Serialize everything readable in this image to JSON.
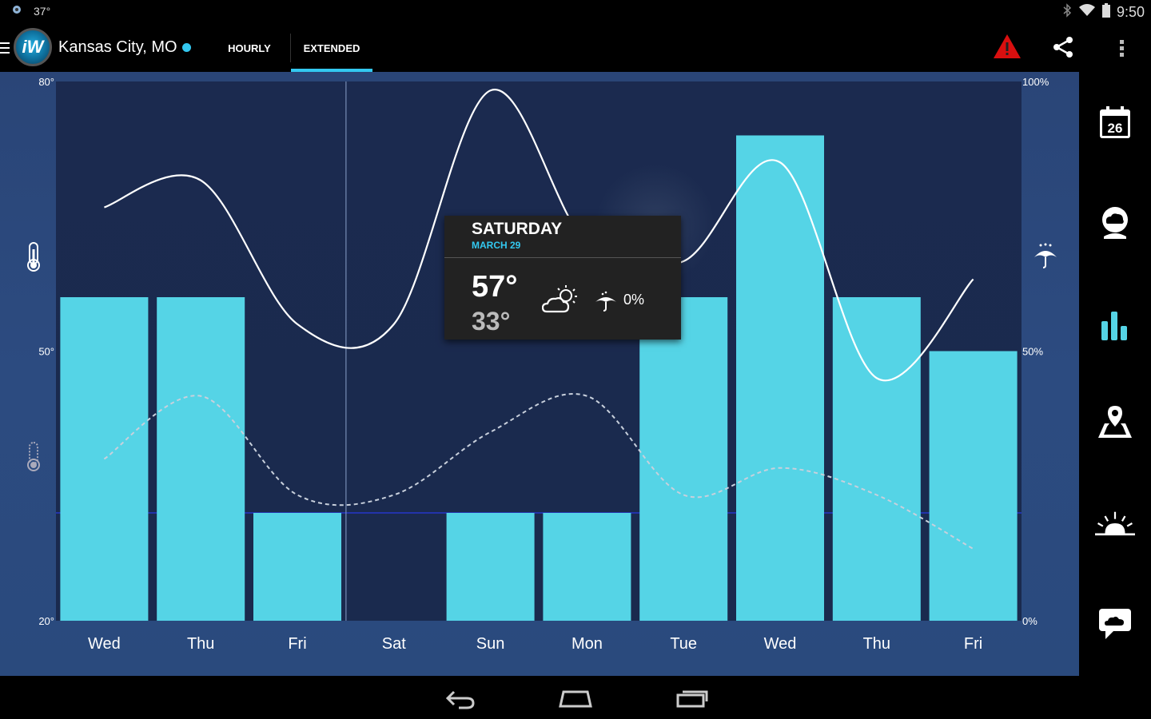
{
  "status_bar": {
    "temp": "37°",
    "time": "9:50"
  },
  "header": {
    "location": "Kansas City, MO",
    "logo_text": "iW",
    "tabs": [
      {
        "label": "HOURLY"
      },
      {
        "label": "EXTENDED"
      }
    ],
    "active_tab": "EXTENDED"
  },
  "sidebar": {
    "items": [
      {
        "icon": "calendar-icon",
        "label": "26"
      },
      {
        "icon": "weather-globe-icon"
      },
      {
        "icon": "bar-chart-icon"
      },
      {
        "icon": "map-icon"
      },
      {
        "icon": "sunrise-icon"
      },
      {
        "icon": "chat-cloud-icon"
      }
    ]
  },
  "tooltip": {
    "day": "SATURDAY",
    "date": "MARCH 29",
    "high": "57°",
    "low": "33°",
    "precip": "0%"
  },
  "colors": {
    "accent": "#33c8f0",
    "bar": "#55d4e6",
    "background": "#2a4577",
    "plot": "#1c2a4d"
  },
  "chart_data": {
    "type": "bar",
    "categories": [
      "Wed",
      "Thu",
      "Fri",
      "Sat",
      "Sun",
      "Mon",
      "Tue",
      "Wed",
      "Thu",
      "Fri"
    ],
    "precip_percent": [
      60,
      60,
      20,
      0,
      20,
      20,
      60,
      90,
      60,
      50
    ],
    "high_temps": [
      66,
      69,
      53,
      53,
      79,
      62,
      60,
      71,
      47,
      58
    ],
    "low_temps": [
      38,
      45,
      34,
      34,
      41,
      45,
      34,
      37,
      34,
      28
    ],
    "left_axis": {
      "ticks": [
        "80°",
        "50°",
        "20°"
      ],
      "values": [
        80,
        50,
        20
      ]
    },
    "right_axis": {
      "ticks": [
        "100%",
        "50%",
        "0%"
      ],
      "values": [
        100,
        50,
        0
      ]
    },
    "selected_index": 3
  }
}
